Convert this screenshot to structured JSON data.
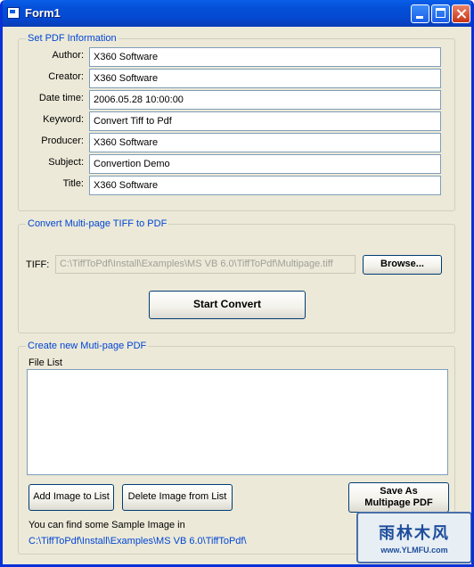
{
  "window": {
    "title": "Form1"
  },
  "info_group": {
    "title": "Set PDF Information",
    "fields": [
      {
        "label": "Author:",
        "value": "X360 Software"
      },
      {
        "label": "Creator:",
        "value": "X360 Software"
      },
      {
        "label": "Date time:",
        "value": "2006.05.28 10:00:00"
      },
      {
        "label": "Keyword:",
        "value": "Convert Tiff to Pdf"
      },
      {
        "label": "Producer:",
        "value": "X360 Software"
      },
      {
        "label": "Subject:",
        "value": "Convertion Demo"
      },
      {
        "label": "Title:",
        "value": "X360 Software"
      }
    ]
  },
  "convert_group": {
    "title": "Convert Multi-page TIFF to PDF",
    "tiff_label": "TIFF:",
    "tiff_path": "C:\\TiffToPdf\\Install\\Examples\\MS VB 6.0\\TiffToPdf\\Multipage.tiff",
    "browse_label": "Browse...",
    "start_label": "Start Convert"
  },
  "create_group": {
    "title": "Create new Muti-page PDF",
    "file_list_label": "File List",
    "add_label": "Add Image to List",
    "delete_label": "Delete Image from List",
    "save_line1": "Save As",
    "save_line2": "Multipage PDF",
    "sample_text": "You can find some Sample Image in",
    "sample_path": "C:\\TiffToPdf\\Install\\Examples\\MS VB 6.0\\TiffToPdf\\"
  },
  "watermark": {
    "text": "雨林木风",
    "url": "www.YLMFU.com"
  },
  "colors": {
    "title_bar": "#0a5ee8",
    "group_title": "#0046d5",
    "link": "#0046d5",
    "face": "#ece9d8"
  }
}
